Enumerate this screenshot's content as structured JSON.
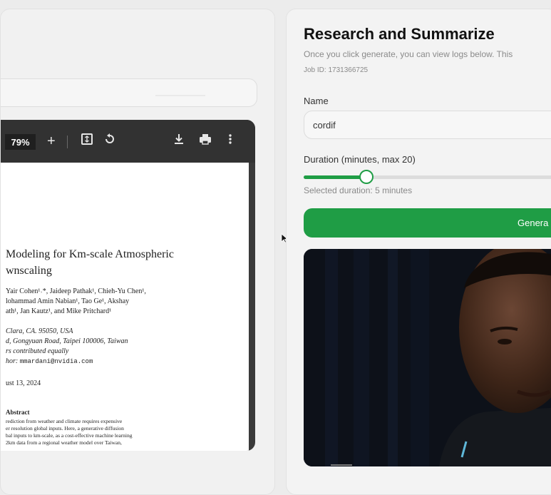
{
  "pdf": {
    "zoom": "79%",
    "title": [
      "Modeling for Km-scale Atmospheric",
      "wnscaling"
    ],
    "authors": [
      "Yair Cohen¹˒*, Jaideep Pathak¹, Chieh-Yu Chen¹,",
      "lohammad Amin Nabian¹, Tao Ge¹, Akshay",
      "ath¹, Jan Kautz¹, and Mike Pritchard¹"
    ],
    "affiliations": [
      "Clara, CA. 95050, USA",
      "d, Gongyuan Road, Taipei 100006, Taiwan",
      "rs contributed equally"
    ],
    "author_label": "hor: ",
    "email": "mmardani@nvidia.com",
    "date": "ust 13, 2024",
    "abstract_heading": "Abstract",
    "abstract_lines": [
      "rediction from weather and climate requires expensive",
      "er resolution global inputs. Here, a generative diffusion",
      "bal inputs to km-scale, as a cost-effective machine learning",
      "2km data from a regional weather model over Taiwan,"
    ]
  },
  "form": {
    "title": "Research and Summarize",
    "subtitle": "Once you click generate, you can view logs below. This",
    "job_id": "Job ID: 1731366725",
    "name_label": "Name",
    "name_value": "cordif",
    "duration_label": "Duration (minutes, max 20)",
    "duration_fraction": 0.235,
    "selected_duration": "Selected duration: 5 minutes",
    "generate_label": "Genera"
  },
  "colors": {
    "accent_green": "#1f9d45"
  },
  "icons": [
    "plus-icon",
    "fit-page-icon",
    "rotate-icon",
    "download-icon",
    "print-icon",
    "more-vert-icon",
    "mouse-cursor-icon"
  ]
}
